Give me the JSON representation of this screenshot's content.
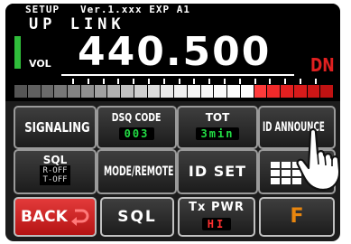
{
  "display": {
    "status_line": "SETUP   Ver.1.xxx EXP A1",
    "band_label": "UP LINK",
    "vol_label": "VOL",
    "frequency": "440.500",
    "shift_direction": "DN"
  },
  "colors": {
    "vol_bar": "#2fbd3a",
    "shift": "#e02020",
    "value_text": "#22dd44",
    "function_key": "#e8860f",
    "back_key": "#cc1f1f"
  },
  "buttons": {
    "signaling": "SIGNALING",
    "dsq_code": {
      "label": "DSQ CODE",
      "value": "003"
    },
    "tot": {
      "label": "TOT",
      "value": "3min"
    },
    "id_announce": "ID ANNOUNCE",
    "sql_mode": {
      "label": "SQL",
      "line1": "R-OFF",
      "line2": "T-OFF"
    },
    "mode_remote": "MODE/REMOTE",
    "id_set": "ID SET",
    "back": "BACK",
    "sql": "SQL",
    "tx_pwr": {
      "label": "Tx PWR",
      "value": "HI"
    },
    "function": "F"
  },
  "icons": {
    "grid": "grid-icon",
    "back_arrow": "return-arrow-icon",
    "hand": "pointing-hand-icon"
  }
}
